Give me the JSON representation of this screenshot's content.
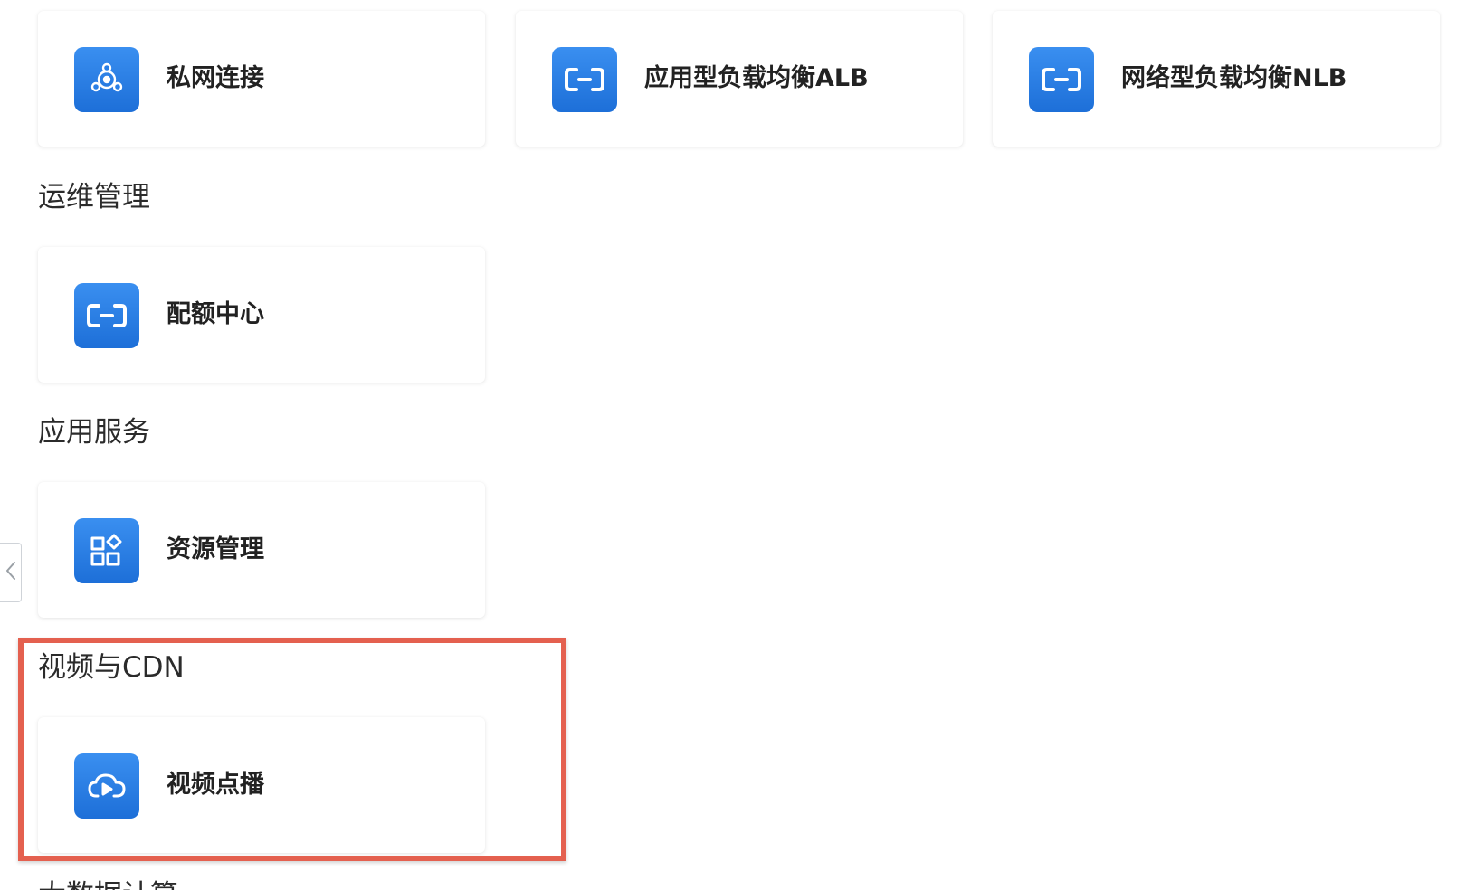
{
  "sections": {
    "network_cards": [
      {
        "label": "私网连接",
        "icon": "privatelink-icon"
      },
      {
        "label": "应用型负载均衡ALB",
        "icon": "aliyun-logo-icon"
      },
      {
        "label": "网络型负载均衡NLB",
        "icon": "aliyun-logo-icon"
      }
    ],
    "ops": {
      "title": "运维管理",
      "cards": [
        {
          "label": "配额中心",
          "icon": "aliyun-logo-icon"
        }
      ]
    },
    "app_services": {
      "title": "应用服务",
      "cards": [
        {
          "label": "资源管理",
          "icon": "resource-grid-icon"
        }
      ]
    },
    "video_cdn": {
      "title": "视频与CDN",
      "cards": [
        {
          "label": "视频点播",
          "icon": "video-cloud-play-icon"
        }
      ]
    },
    "next_section_partial": {
      "title": "大数据计算"
    }
  },
  "colors": {
    "icon_bg": "#1d6fd8",
    "highlight": "#e4604f",
    "text": "#222222"
  }
}
